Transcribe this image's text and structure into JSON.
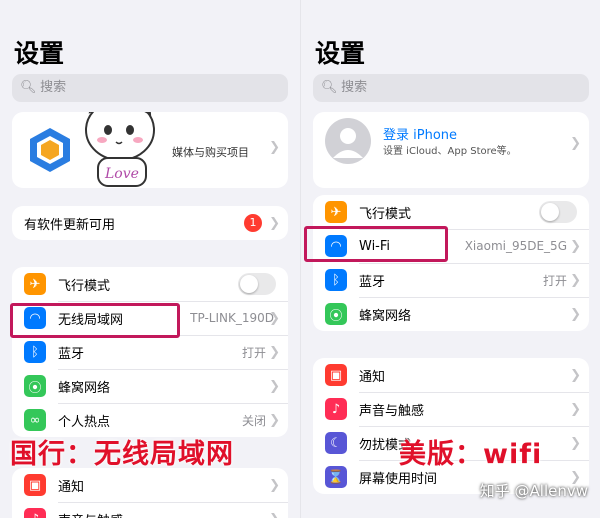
{
  "left": {
    "title": "设置",
    "search_placeholder": "搜索",
    "account_subtitle": "媒体与购买项目",
    "update_label": "有软件更新可用",
    "update_badge": "1",
    "rows": [
      {
        "label": "飞行模式",
        "icon": "airplane-icon",
        "color": "#ff9500"
      },
      {
        "label": "无线局域网",
        "value": "TP-LINK_190D",
        "icon": "wifi-icon",
        "color": "#007aff"
      },
      {
        "label": "蓝牙",
        "value": "打开",
        "icon": "bluetooth-icon",
        "color": "#007aff"
      },
      {
        "label": "蜂窝网络",
        "icon": "cellular-icon",
        "color": "#34c759"
      },
      {
        "label": "个人热点",
        "value": "关闭",
        "icon": "hotspot-icon",
        "color": "#34c759"
      }
    ],
    "rows2": [
      {
        "label": "通知",
        "icon": "notification-icon",
        "color": "#ff3b30"
      },
      {
        "label": "声音与触感",
        "icon": "sound-icon",
        "color": "#ff2d55"
      }
    ],
    "banner": "国行：无线局域网"
  },
  "right": {
    "title": "设置",
    "search_placeholder": "搜索",
    "signin_label": "登录 iPhone",
    "signin_subtitle": "设置 iCloud、App Store等。",
    "rows": [
      {
        "label": "飞行模式",
        "icon": "airplane-icon",
        "color": "#ff9500"
      },
      {
        "label": "Wi-Fi",
        "value": "Xiaomi_95DE_5G",
        "icon": "wifi-icon",
        "color": "#007aff"
      },
      {
        "label": "蓝牙",
        "value": "打开",
        "icon": "bluetooth-icon",
        "color": "#007aff"
      },
      {
        "label": "蜂窝网络",
        "icon": "cellular-icon",
        "color": "#34c759"
      }
    ],
    "rows2": [
      {
        "label": "通知",
        "icon": "notification-icon",
        "color": "#ff3b30"
      },
      {
        "label": "声音与触感",
        "icon": "sound-icon",
        "color": "#ff2d55"
      },
      {
        "label": "勿扰模式",
        "icon": "moon-icon",
        "color": "#5856d6"
      },
      {
        "label": "屏幕使用时间",
        "icon": "hourglass-icon",
        "color": "#5856d6"
      }
    ],
    "banner": "美版：wifi"
  },
  "watermark": "知乎 @Allenvw"
}
